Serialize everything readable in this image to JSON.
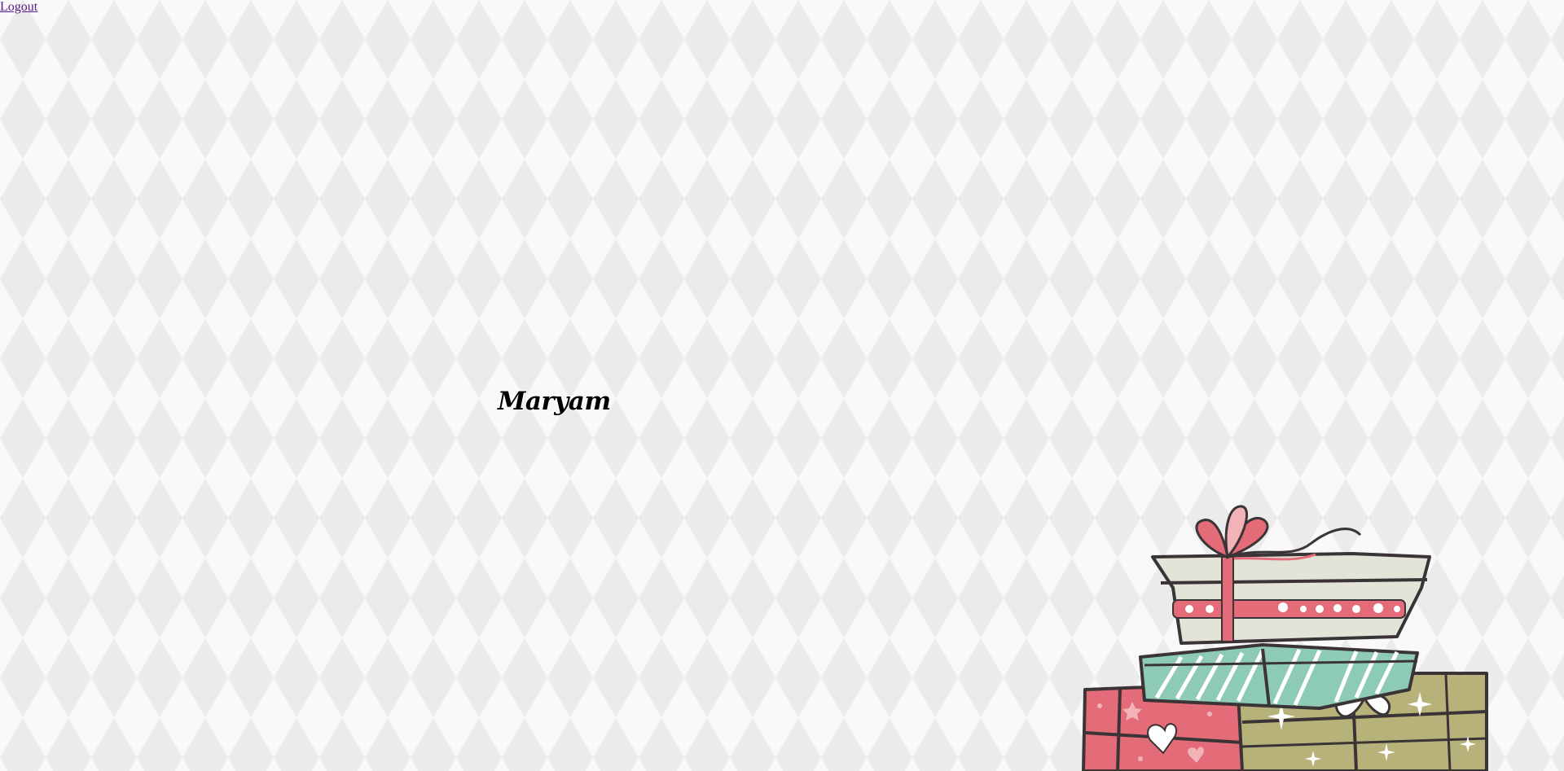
{
  "header": {
    "logout_label": "Logout"
  },
  "profile": {
    "name": "Maryam"
  },
  "decoration": {
    "illustration": "stacked-gift-boxes",
    "colors": {
      "ribbon_pink": "#e46c79",
      "box_cream": "#e3e4d8",
      "box_mint": "#8ecbb5",
      "box_olive": "#b7b27a",
      "outline": "#3b3437"
    }
  },
  "page": {
    "background": "#f1f1f1",
    "link_color": "#551a8b"
  }
}
